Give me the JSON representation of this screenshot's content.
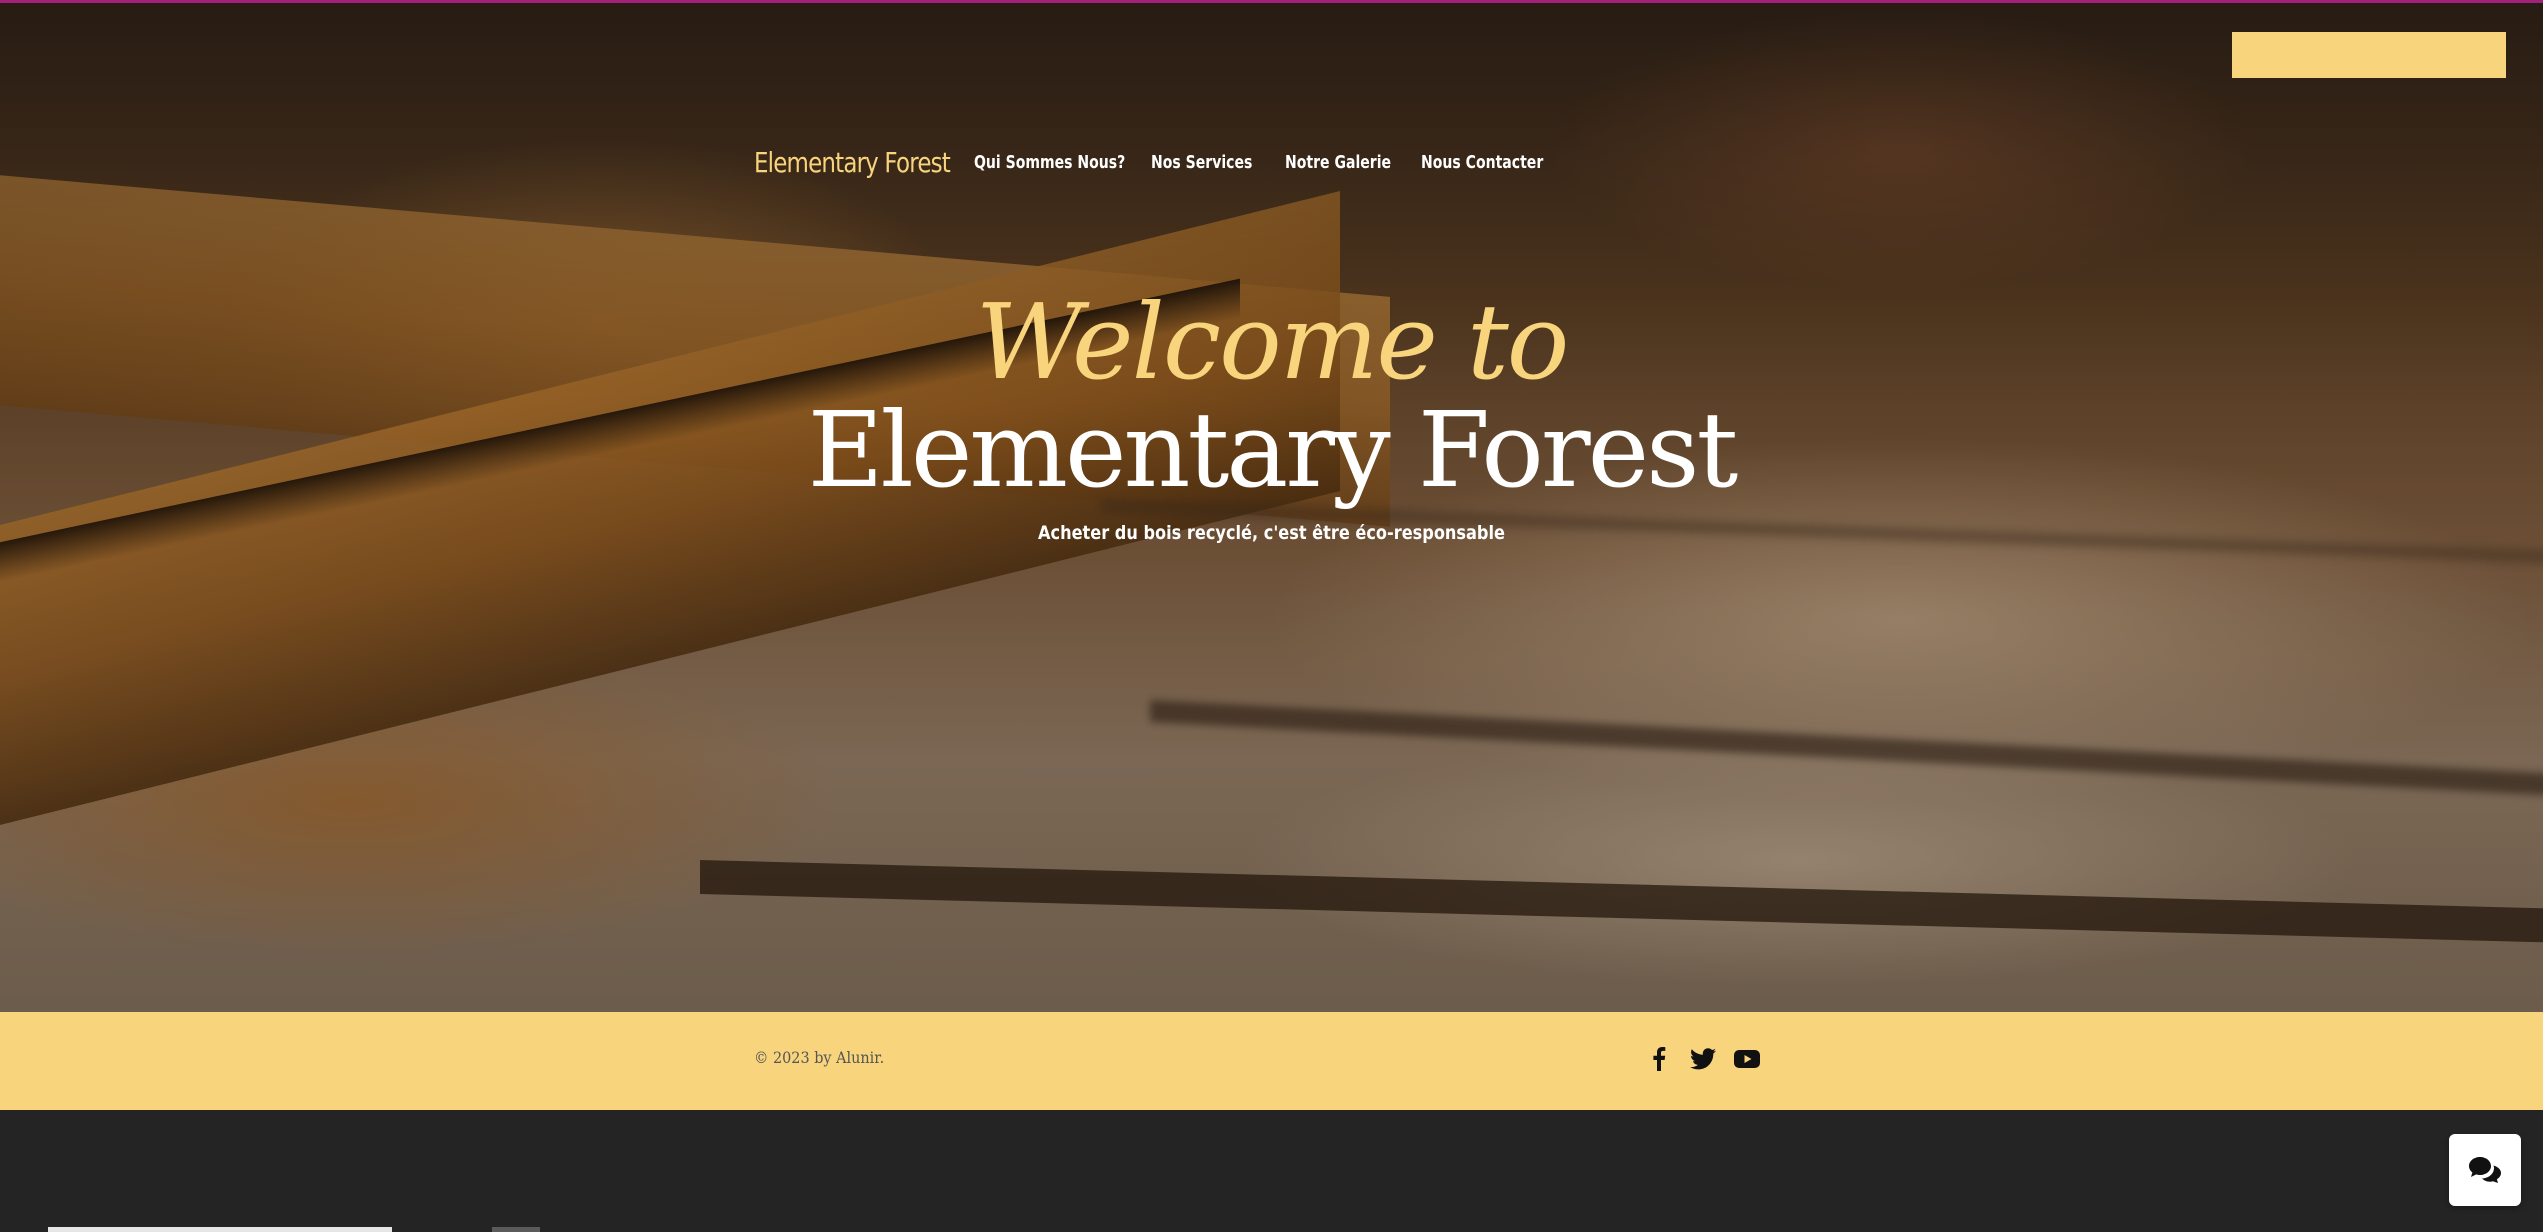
{
  "site": {
    "brand": "Elementary Forest",
    "nav": [
      {
        "label": "Qui Sommes Nous?"
      },
      {
        "label": "Nos Services"
      },
      {
        "label": "Notre Galerie"
      },
      {
        "label": "Nous Contacter"
      }
    ]
  },
  "hero": {
    "welcome": "Welcome to",
    "title": "Elementary Forest",
    "subtitle": "Acheter du bois recyclé, c'est être éco-responsable"
  },
  "footer": {
    "copyright": "© 2023 by Alunir.",
    "socials": [
      {
        "icon": "facebook-icon"
      },
      {
        "icon": "twitter-icon"
      },
      {
        "icon": "youtube-icon"
      }
    ]
  },
  "colors": {
    "accent": "#f8d47c",
    "dark": "#242424",
    "white": "#ffffff",
    "border": "#a3217a"
  },
  "chat": {
    "icon": "chat-icon"
  }
}
